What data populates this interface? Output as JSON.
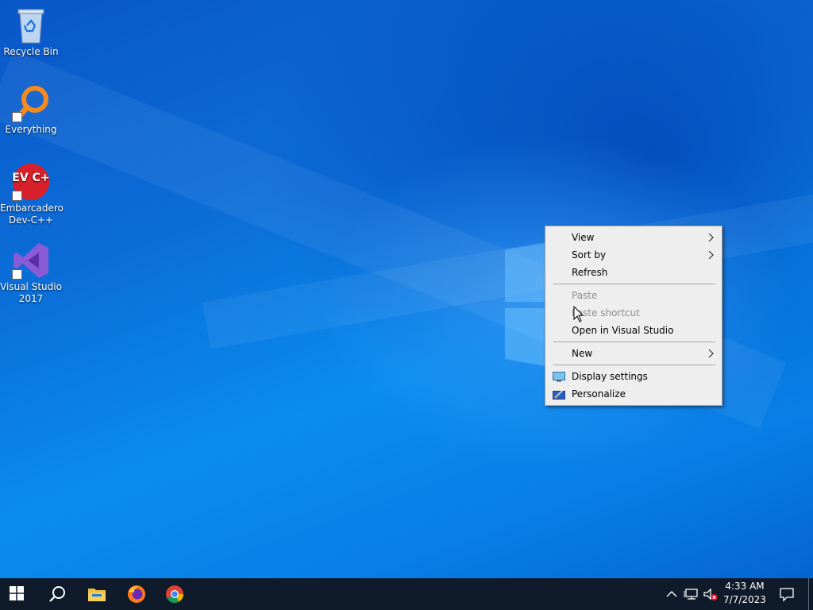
{
  "desktop": {
    "icons": [
      {
        "label": "Recycle Bin",
        "icon": "recycle-bin-icon"
      },
      {
        "label": "Everything",
        "icon": "everything-search-icon"
      },
      {
        "label": "Embarcadero Dev-C++",
        "icon": "dev-cpp-icon",
        "icon_text": "DEV C++"
      },
      {
        "label": "Visual Studio 2017",
        "icon": "visual-studio-icon"
      }
    ]
  },
  "context_menu": {
    "items": [
      {
        "label": "View",
        "has_submenu": true,
        "enabled": true
      },
      {
        "label": "Sort by",
        "has_submenu": true,
        "enabled": true
      },
      {
        "label": "Refresh",
        "has_submenu": false,
        "enabled": true
      },
      {
        "label": "Paste",
        "has_submenu": false,
        "enabled": false
      },
      {
        "label": "Paste shortcut",
        "has_submenu": false,
        "enabled": false
      },
      {
        "label": "Open in Visual Studio",
        "has_submenu": false,
        "enabled": true
      },
      {
        "label": "New",
        "has_submenu": true,
        "enabled": true
      },
      {
        "label": "Display settings",
        "has_submenu": false,
        "enabled": true,
        "icon": "display-icon"
      },
      {
        "label": "Personalize",
        "has_submenu": false,
        "enabled": true,
        "icon": "personalize-icon"
      }
    ]
  },
  "taskbar": {
    "pinned": [
      "start-button",
      "search-button",
      "file-explorer",
      "firefox",
      "chrome"
    ],
    "tray": {
      "time": "4:33 AM",
      "date": "7/7/2023"
    }
  },
  "colors": {
    "taskbar": "#0f1a2a",
    "menu_bg": "#eeeeee",
    "menu_disabled_text": "#8d8d8d",
    "desktop_blue": "#0b6fd9"
  }
}
